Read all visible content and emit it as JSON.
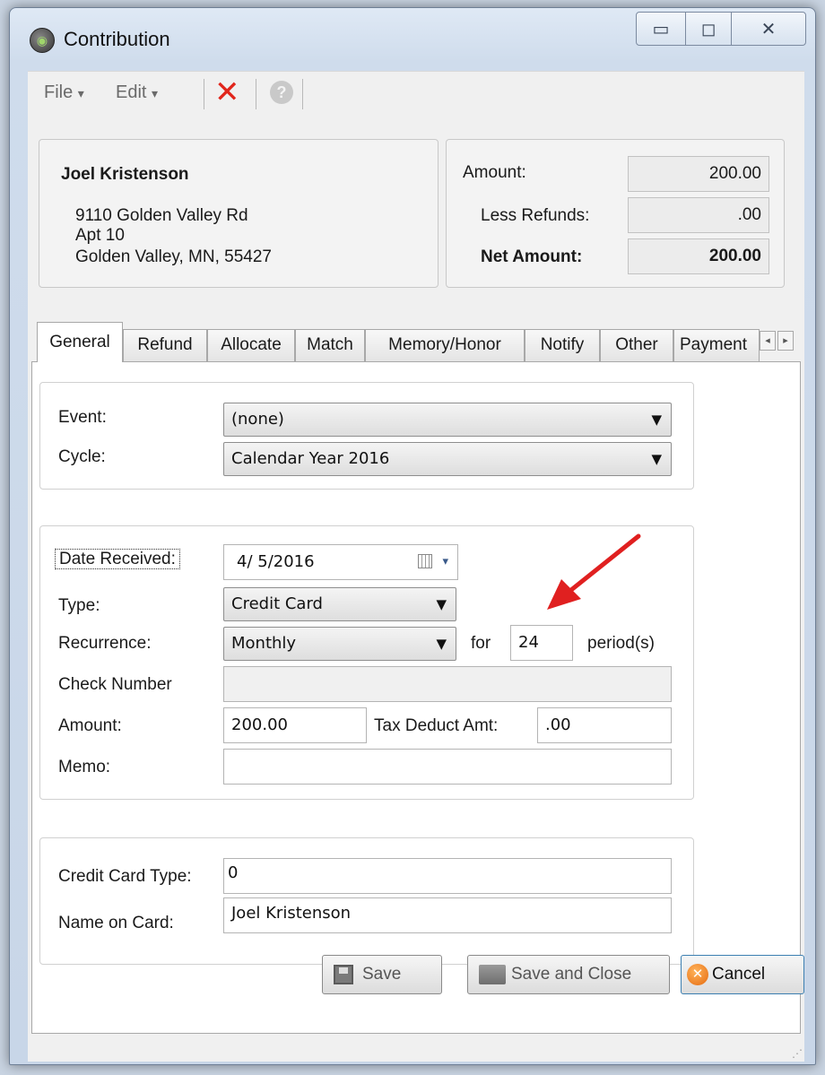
{
  "window": {
    "title": "Contribution",
    "icon": "app-globe-icon"
  },
  "menu": {
    "file": "File",
    "edit": "Edit",
    "dropdown_glyph": "▾"
  },
  "donor": {
    "name": "Joel Kristenson",
    "address_line1": "9110 Golden Valley Rd",
    "address_line2": "Apt 10",
    "address_line3": "Golden Valley, MN, 55427"
  },
  "totals": {
    "amount_label": "Amount:",
    "amount_value": "200.00",
    "refunds_label": "Less Refunds:",
    "refunds_value": ".00",
    "net_label": "Net Amount:",
    "net_value": "200.00"
  },
  "tabs": [
    {
      "label": "General",
      "active": true
    },
    {
      "label": "Refund"
    },
    {
      "label": "Allocate"
    },
    {
      "label": "Match"
    },
    {
      "label": "Memory/Honor"
    },
    {
      "label": "Notify"
    },
    {
      "label": "Other"
    },
    {
      "label": "Payment"
    }
  ],
  "general": {
    "event_label": "Event:",
    "event_value": "(none)",
    "cycle_label": "Cycle:",
    "cycle_value": "Calendar Year 2016",
    "date_label": "Date Received:",
    "date_value": "4/  5/2016",
    "type_label": "Type:",
    "type_value": "Credit Card",
    "recurrence_label": "Recurrence:",
    "recurrence_value": "Monthly",
    "for_label": "for",
    "periods_value": "24",
    "periods_label": "period(s)",
    "check_label": "Check Number",
    "check_value": "",
    "amount_label": "Amount:",
    "amount_value": "200.00",
    "tax_label": "Tax Deduct Amt:",
    "tax_value": ".00",
    "memo_label": "Memo:",
    "memo_value": "",
    "cc_type_label": "Credit Card Type:",
    "cc_type_value": "0",
    "name_on_card_label": "Name on Card:",
    "name_on_card_value": "Joel Kristenson"
  },
  "buttons": {
    "save": "Save",
    "save_close": "Save and Close",
    "cancel": "Cancel"
  },
  "colors": {
    "annotation_arrow": "#e02020",
    "delete_icon": "#e1261c"
  }
}
